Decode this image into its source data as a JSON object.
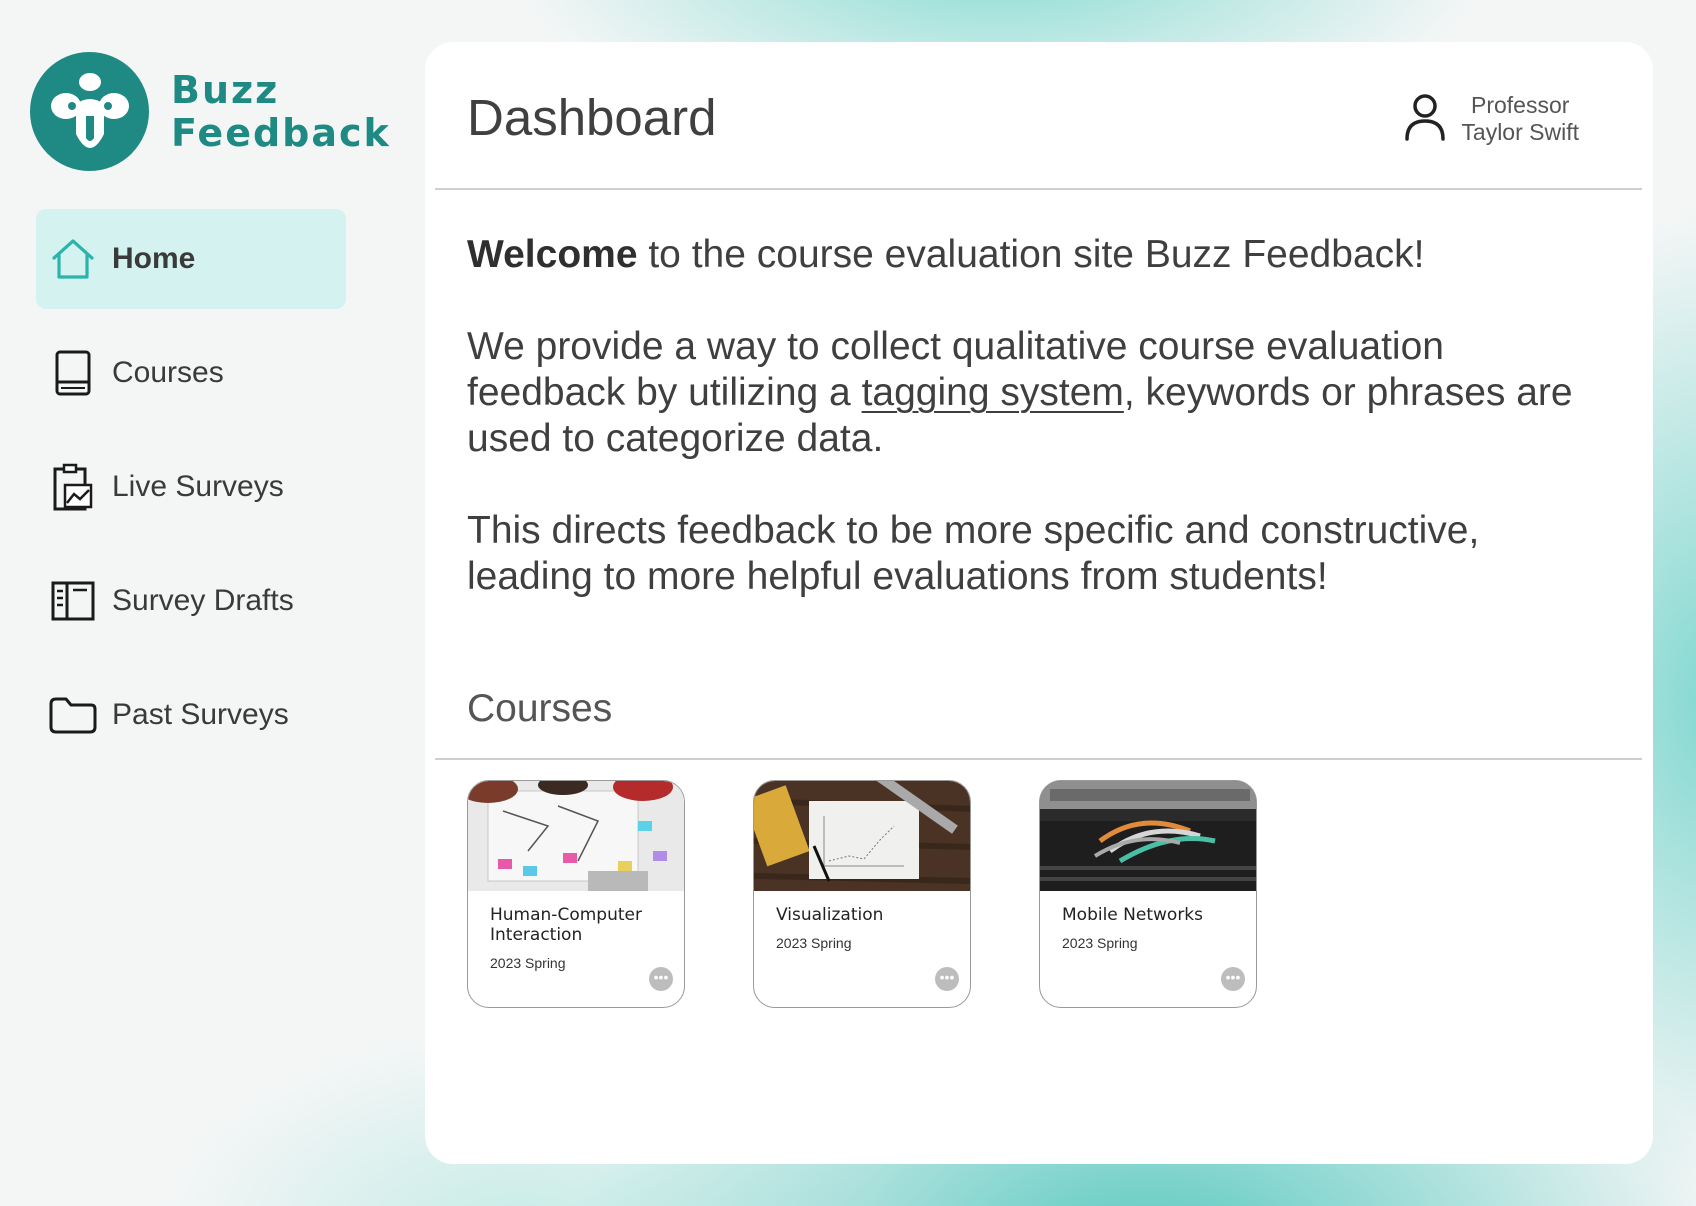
{
  "app": {
    "name_line1": "Buzz",
    "name_line2": "Feedback",
    "brand_color": "#1f8a83",
    "accent_active_bg": "#d4f3f0"
  },
  "sidebar": {
    "items": [
      {
        "label": "Home",
        "icon": "home-icon",
        "active": true
      },
      {
        "label": "Courses",
        "icon": "book-icon",
        "active": false
      },
      {
        "label": "Live Surveys",
        "icon": "clipboard-chart-icon",
        "active": false
      },
      {
        "label": "Survey Drafts",
        "icon": "draft-icon",
        "active": false
      },
      {
        "label": "Past Surveys",
        "icon": "folder-icon",
        "active": false
      }
    ]
  },
  "header": {
    "title": "Dashboard",
    "user_role": "Professor",
    "user_name": "Taylor Swift"
  },
  "welcome": {
    "bold": "Welcome",
    "line1_rest": " to the course evaluation site Buzz Feedback!",
    "p2_before": "We provide a way to collect qualitative course evaluation feedback by utilizing a ",
    "p2_link": "tagging system",
    "p2_after": ", keywords or phrases are used to categorize data.",
    "p3": "This directs feedback to be more specific and constructive, leading to more helpful evaluations from students!"
  },
  "courses_section": {
    "title": "Courses",
    "courses": [
      {
        "title": "Human-Computer Interaction",
        "term": "2023 Spring"
      },
      {
        "title": "Visualization",
        "term": "2023 Spring"
      },
      {
        "title": "Mobile Networks",
        "term": "2023 Spring"
      }
    ]
  }
}
